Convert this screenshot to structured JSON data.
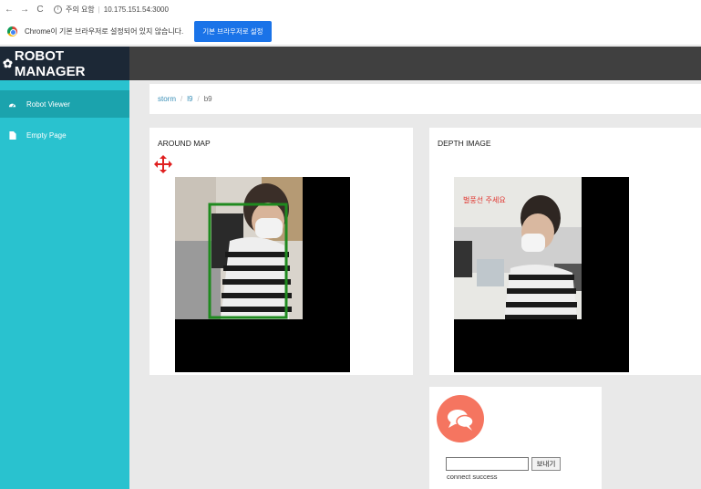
{
  "browser": {
    "back": "←",
    "forward": "→",
    "reload": "C",
    "security_label": "주의 요함",
    "url": "10.175.151.54:3000"
  },
  "notice": {
    "text": "Chrome이 기본 브라우저로 설정되어 있지 않습니다.",
    "button": "기본 브라우저로 설정"
  },
  "app": {
    "brand": "ROBOT MANAGER"
  },
  "sidebar": {
    "items": [
      {
        "label": "Robot Viewer",
        "icon": "dashboard-icon",
        "active": true
      },
      {
        "label": "Empty Page",
        "icon": "file-icon",
        "active": false
      }
    ],
    "collapse_glyph": "›"
  },
  "breadcrumb": [
    "storm",
    "l9",
    "b9"
  ],
  "panels": {
    "around_map": {
      "title": "AROUND MAP"
    },
    "depth_image": {
      "title": "DEPTH IMAGE",
      "overlay_text": "벌풍선 주세요"
    }
  },
  "chat": {
    "input_value": "",
    "send_label": "보내기",
    "status": "connect success"
  },
  "colors": {
    "sidebar": "#29c2cf",
    "sidebar_active": "#1ba3ad",
    "header": "#404040",
    "brand_bg": "#1c2836",
    "chat_bubble": "#f57560",
    "detection_box": "#1f8a1f",
    "notice_button": "#1a73e8"
  }
}
